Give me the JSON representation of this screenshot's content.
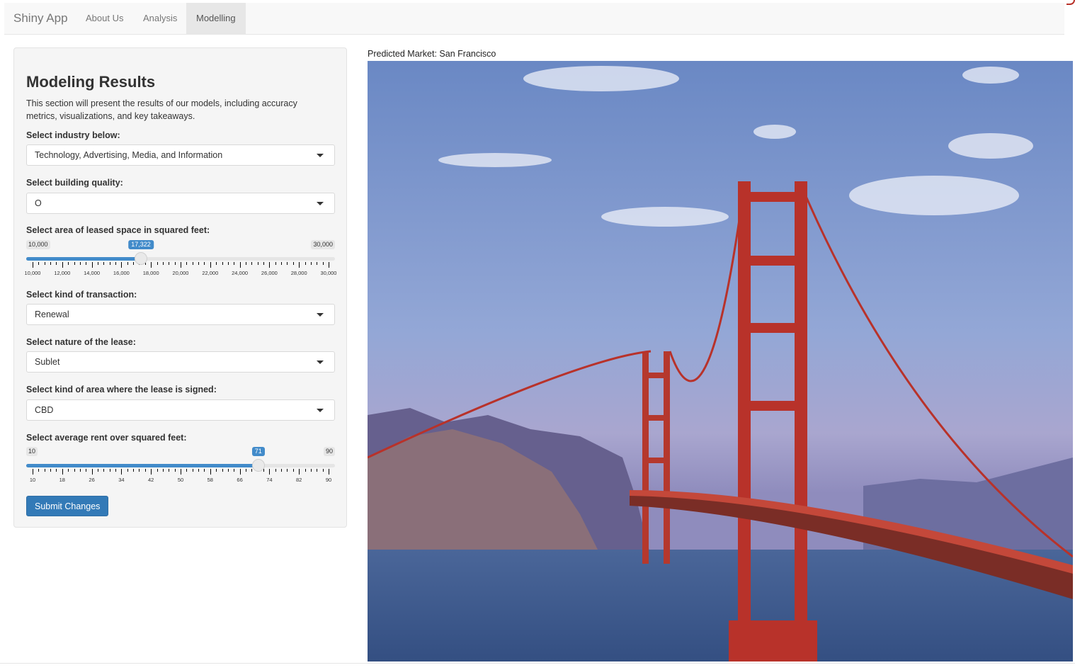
{
  "navbar": {
    "brand": "Shiny App",
    "tabs": [
      {
        "label": "About Us",
        "active": false
      },
      {
        "label": "Analysis",
        "active": false
      },
      {
        "label": "Modelling",
        "active": true
      }
    ]
  },
  "sidebar": {
    "title": "Modeling Results",
    "description": "This section will present the results of our models, including accuracy metrics, visualizations, and key takeaways.",
    "industry": {
      "label": "Select industry below:",
      "value": "Technology, Advertising, Media, and Information"
    },
    "quality": {
      "label": "Select building quality:",
      "value": "O"
    },
    "area": {
      "label": "Select area of leased space in squared feet:",
      "min": 10000,
      "max": 30000,
      "value": 17322,
      "min_label": "10,000",
      "max_label": "30,000",
      "value_label": "17,322",
      "ticks": [
        "10,000",
        "12,000",
        "14,000",
        "16,000",
        "18,000",
        "20,000",
        "22,000",
        "24,000",
        "26,000",
        "28,000",
        "30,000"
      ]
    },
    "transaction": {
      "label": "Select kind of transaction:",
      "value": "Renewal"
    },
    "lease_nature": {
      "label": "Select nature of the lease:",
      "value": "Sublet"
    },
    "area_kind": {
      "label": "Select kind of area where the lease is signed:",
      "value": "CBD"
    },
    "rent": {
      "label": "Select average rent over squared feet:",
      "min": 10,
      "max": 90,
      "value": 71,
      "min_label": "10",
      "max_label": "90",
      "value_label": "71",
      "ticks": [
        "10",
        "18",
        "26",
        "34",
        "42",
        "50",
        "58",
        "66",
        "74",
        "82",
        "90"
      ]
    },
    "submit_label": "Submit Changes"
  },
  "main": {
    "prediction": "Predicted Market: San Francisco"
  },
  "colors": {
    "accent": "#428bca",
    "button": "#337ab7",
    "bridge": "#b8322a"
  }
}
